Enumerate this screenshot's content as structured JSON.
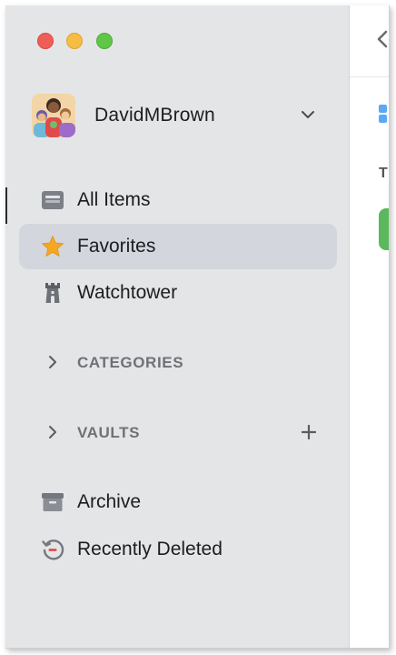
{
  "window": {
    "traffic_lights": [
      "close",
      "minimize",
      "zoom"
    ]
  },
  "account": {
    "name": "DavidMBrown",
    "chevron_icon": "chevron-down-icon"
  },
  "nav": {
    "items": [
      {
        "label": "All Items",
        "icon": "all-items-icon",
        "selected": false
      },
      {
        "label": "Favorites",
        "icon": "star-icon",
        "selected": true
      },
      {
        "label": "Watchtower",
        "icon": "watchtower-icon",
        "selected": false
      }
    ]
  },
  "sections": {
    "categories": {
      "label": "CATEGORIES"
    },
    "vaults": {
      "label": "VAULTS"
    }
  },
  "footer": {
    "items": [
      {
        "label": "Archive",
        "icon": "archive-icon"
      },
      {
        "label": "Recently Deleted",
        "icon": "recently-deleted-icon"
      }
    ]
  },
  "content": {
    "partial_letter": "T"
  },
  "colors": {
    "sidebar_bg": "#e4e5e7",
    "selected_bg": "#d3d6dd",
    "star": "#f5a623",
    "section_text": "#6f7175",
    "green_badge": "#5cb85c"
  }
}
